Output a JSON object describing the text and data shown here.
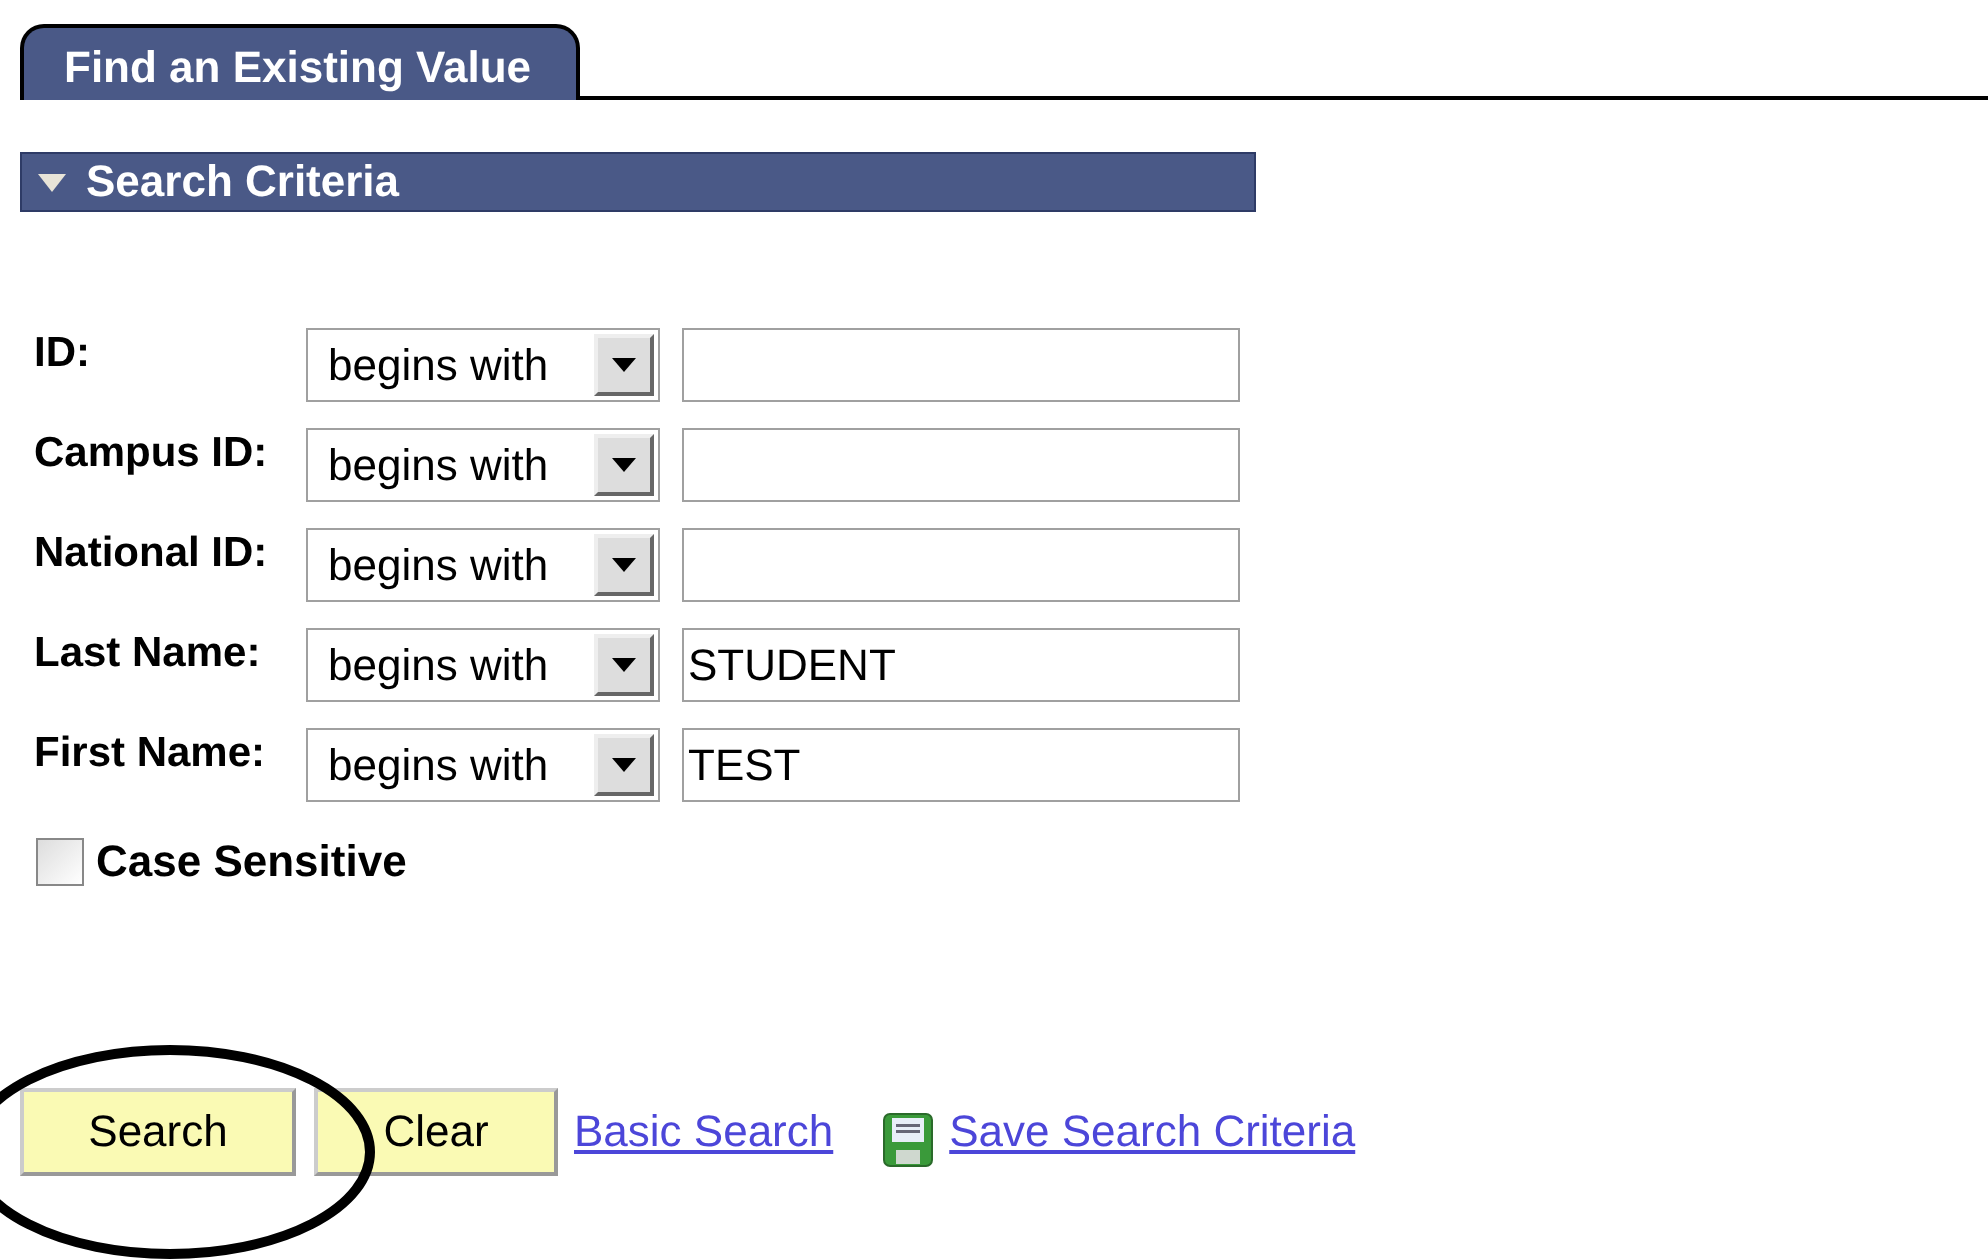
{
  "tabs": [
    {
      "label": "Find an Existing Value",
      "selected": true
    }
  ],
  "section": {
    "title": "Search Criteria",
    "expanded": true
  },
  "fields": [
    {
      "label": "ID:",
      "operator": "begins with"
    },
    {
      "label": "Campus ID:",
      "operator": "begins with"
    },
    {
      "label": "National ID:",
      "operator": "begins with"
    },
    {
      "label": "Last Name:",
      "operator": "begins with",
      "value": "STUDENT"
    },
    {
      "label": "First Name:",
      "operator": "begins with",
      "value": "TEST"
    }
  ],
  "case_sensitive": {
    "label": "Case Sensitive",
    "checked": false
  },
  "buttons": [
    "Search",
    "Clear"
  ],
  "links": [
    {
      "label": "Basic Search",
      "kind": "link"
    },
    {
      "label": "Save Search Criteria",
      "kind": "save"
    }
  ]
}
